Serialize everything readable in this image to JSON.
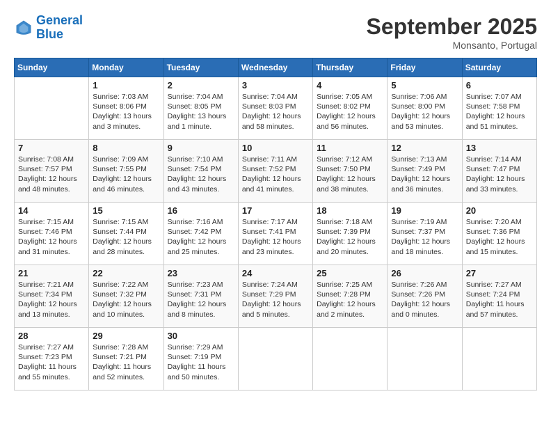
{
  "header": {
    "logo_line1": "General",
    "logo_line2": "Blue",
    "month": "September 2025",
    "location": "Monsanto, Portugal"
  },
  "weekdays": [
    "Sunday",
    "Monday",
    "Tuesday",
    "Wednesday",
    "Thursday",
    "Friday",
    "Saturday"
  ],
  "weeks": [
    [
      {
        "day": "",
        "sunrise": "",
        "sunset": "",
        "daylight": ""
      },
      {
        "day": "1",
        "sunrise": "Sunrise: 7:03 AM",
        "sunset": "Sunset: 8:06 PM",
        "daylight": "Daylight: 13 hours and 3 minutes."
      },
      {
        "day": "2",
        "sunrise": "Sunrise: 7:04 AM",
        "sunset": "Sunset: 8:05 PM",
        "daylight": "Daylight: 13 hours and 1 minute."
      },
      {
        "day": "3",
        "sunrise": "Sunrise: 7:04 AM",
        "sunset": "Sunset: 8:03 PM",
        "daylight": "Daylight: 12 hours and 58 minutes."
      },
      {
        "day": "4",
        "sunrise": "Sunrise: 7:05 AM",
        "sunset": "Sunset: 8:02 PM",
        "daylight": "Daylight: 12 hours and 56 minutes."
      },
      {
        "day": "5",
        "sunrise": "Sunrise: 7:06 AM",
        "sunset": "Sunset: 8:00 PM",
        "daylight": "Daylight: 12 hours and 53 minutes."
      },
      {
        "day": "6",
        "sunrise": "Sunrise: 7:07 AM",
        "sunset": "Sunset: 7:58 PM",
        "daylight": "Daylight: 12 hours and 51 minutes."
      }
    ],
    [
      {
        "day": "7",
        "sunrise": "Sunrise: 7:08 AM",
        "sunset": "Sunset: 7:57 PM",
        "daylight": "Daylight: 12 hours and 48 minutes."
      },
      {
        "day": "8",
        "sunrise": "Sunrise: 7:09 AM",
        "sunset": "Sunset: 7:55 PM",
        "daylight": "Daylight: 12 hours and 46 minutes."
      },
      {
        "day": "9",
        "sunrise": "Sunrise: 7:10 AM",
        "sunset": "Sunset: 7:54 PM",
        "daylight": "Daylight: 12 hours and 43 minutes."
      },
      {
        "day": "10",
        "sunrise": "Sunrise: 7:11 AM",
        "sunset": "Sunset: 7:52 PM",
        "daylight": "Daylight: 12 hours and 41 minutes."
      },
      {
        "day": "11",
        "sunrise": "Sunrise: 7:12 AM",
        "sunset": "Sunset: 7:50 PM",
        "daylight": "Daylight: 12 hours and 38 minutes."
      },
      {
        "day": "12",
        "sunrise": "Sunrise: 7:13 AM",
        "sunset": "Sunset: 7:49 PM",
        "daylight": "Daylight: 12 hours and 36 minutes."
      },
      {
        "day": "13",
        "sunrise": "Sunrise: 7:14 AM",
        "sunset": "Sunset: 7:47 PM",
        "daylight": "Daylight: 12 hours and 33 minutes."
      }
    ],
    [
      {
        "day": "14",
        "sunrise": "Sunrise: 7:15 AM",
        "sunset": "Sunset: 7:46 PM",
        "daylight": "Daylight: 12 hours and 31 minutes."
      },
      {
        "day": "15",
        "sunrise": "Sunrise: 7:15 AM",
        "sunset": "Sunset: 7:44 PM",
        "daylight": "Daylight: 12 hours and 28 minutes."
      },
      {
        "day": "16",
        "sunrise": "Sunrise: 7:16 AM",
        "sunset": "Sunset: 7:42 PM",
        "daylight": "Daylight: 12 hours and 25 minutes."
      },
      {
        "day": "17",
        "sunrise": "Sunrise: 7:17 AM",
        "sunset": "Sunset: 7:41 PM",
        "daylight": "Daylight: 12 hours and 23 minutes."
      },
      {
        "day": "18",
        "sunrise": "Sunrise: 7:18 AM",
        "sunset": "Sunset: 7:39 PM",
        "daylight": "Daylight: 12 hours and 20 minutes."
      },
      {
        "day": "19",
        "sunrise": "Sunrise: 7:19 AM",
        "sunset": "Sunset: 7:37 PM",
        "daylight": "Daylight: 12 hours and 18 minutes."
      },
      {
        "day": "20",
        "sunrise": "Sunrise: 7:20 AM",
        "sunset": "Sunset: 7:36 PM",
        "daylight": "Daylight: 12 hours and 15 minutes."
      }
    ],
    [
      {
        "day": "21",
        "sunrise": "Sunrise: 7:21 AM",
        "sunset": "Sunset: 7:34 PM",
        "daylight": "Daylight: 12 hours and 13 minutes."
      },
      {
        "day": "22",
        "sunrise": "Sunrise: 7:22 AM",
        "sunset": "Sunset: 7:32 PM",
        "daylight": "Daylight: 12 hours and 10 minutes."
      },
      {
        "day": "23",
        "sunrise": "Sunrise: 7:23 AM",
        "sunset": "Sunset: 7:31 PM",
        "daylight": "Daylight: 12 hours and 8 minutes."
      },
      {
        "day": "24",
        "sunrise": "Sunrise: 7:24 AM",
        "sunset": "Sunset: 7:29 PM",
        "daylight": "Daylight: 12 hours and 5 minutes."
      },
      {
        "day": "25",
        "sunrise": "Sunrise: 7:25 AM",
        "sunset": "Sunset: 7:28 PM",
        "daylight": "Daylight: 12 hours and 2 minutes."
      },
      {
        "day": "26",
        "sunrise": "Sunrise: 7:26 AM",
        "sunset": "Sunset: 7:26 PM",
        "daylight": "Daylight: 12 hours and 0 minutes."
      },
      {
        "day": "27",
        "sunrise": "Sunrise: 7:27 AM",
        "sunset": "Sunset: 7:24 PM",
        "daylight": "Daylight: 11 hours and 57 minutes."
      }
    ],
    [
      {
        "day": "28",
        "sunrise": "Sunrise: 7:27 AM",
        "sunset": "Sunset: 7:23 PM",
        "daylight": "Daylight: 11 hours and 55 minutes."
      },
      {
        "day": "29",
        "sunrise": "Sunrise: 7:28 AM",
        "sunset": "Sunset: 7:21 PM",
        "daylight": "Daylight: 11 hours and 52 minutes."
      },
      {
        "day": "30",
        "sunrise": "Sunrise: 7:29 AM",
        "sunset": "Sunset: 7:19 PM",
        "daylight": "Daylight: 11 hours and 50 minutes."
      },
      {
        "day": "",
        "sunrise": "",
        "sunset": "",
        "daylight": ""
      },
      {
        "day": "",
        "sunrise": "",
        "sunset": "",
        "daylight": ""
      },
      {
        "day": "",
        "sunrise": "",
        "sunset": "",
        "daylight": ""
      },
      {
        "day": "",
        "sunrise": "",
        "sunset": "",
        "daylight": ""
      }
    ]
  ]
}
